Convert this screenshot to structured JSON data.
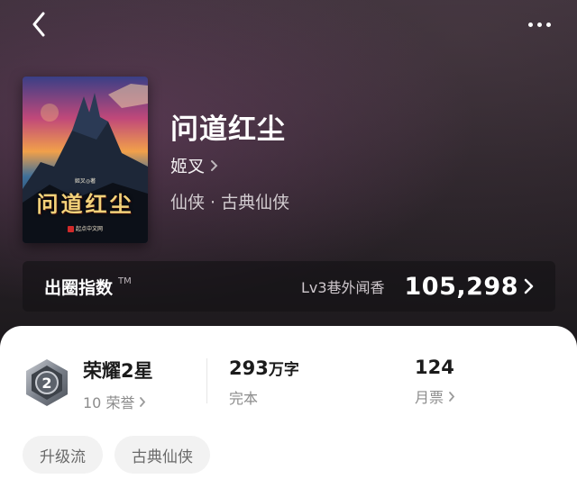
{
  "header": {
    "back_icon": "chevron-left-icon",
    "more_icon": "more-dots-icon"
  },
  "book": {
    "title": "问道红尘",
    "author": "姬叉",
    "genres": "仙侠 · 古典仙侠",
    "cover": {
      "title_text": "问道红尘",
      "author_text": "姬叉◎著",
      "publisher_text": "起点中文网"
    }
  },
  "index": {
    "label": "出圈指数",
    "tm": "TM",
    "level": "Lv3巷外闻香",
    "value": "105,298"
  },
  "stats": {
    "honor": {
      "title": "荣耀2星",
      "sub": "10 荣誉",
      "badge_number": "2"
    },
    "words": {
      "number": "293",
      "unit": "万字",
      "sub": "完本"
    },
    "tickets": {
      "number": "124",
      "sub": "月票"
    }
  },
  "tags": [
    "升级流",
    "古典仙侠"
  ],
  "colors": {
    "hero_bg": "#2a2329",
    "card_bg": "#ffffff",
    "cover_title": "#f3d27a",
    "muted_text": "#8c8c8c"
  }
}
